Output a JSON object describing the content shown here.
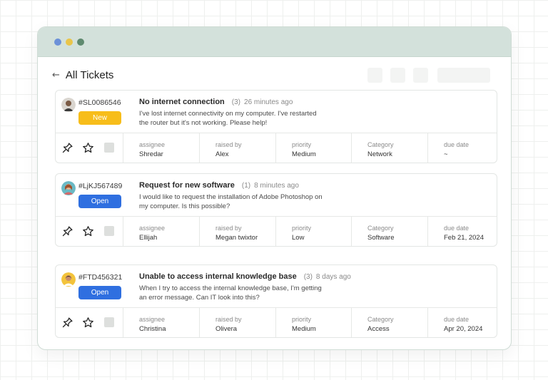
{
  "header": {
    "back_arrow": "←",
    "title": "All Tickets"
  },
  "columns": [
    "assignee",
    "raised by",
    "priority",
    "Category",
    "due date"
  ],
  "colors": {
    "new": "#f7bd1a",
    "open": "#2f6fe0",
    "titlebar": "#d3e1db"
  },
  "tickets": [
    {
      "id": "#SL0086546",
      "status": "New",
      "title": "No internet connection",
      "count": "(3)",
      "time": "26 minutes ago",
      "description": "I've lost internet connectivity on my computer. I've restarted the router but it's not working. Please help!",
      "assignee": "Shredar",
      "raised_by": "Alex",
      "priority": "Medium",
      "category": "Network",
      "due_date": "~"
    },
    {
      "id": "#LjKJ567489",
      "status": "Open",
      "title": "Request for new software",
      "count": "(1)",
      "time": "8 minutes ago",
      "description": "I would like to request the installation of Adobe Photoshop on my computer. Is this possible?",
      "assignee": "Ellijah",
      "raised_by": "Megan twixtor",
      "priority": "Low",
      "category": "Software",
      "due_date": "Feb 21, 2024"
    },
    {
      "id": "#FTD456321",
      "status": "Open",
      "title": "Unable to access internal knowledge base",
      "count": "(3)",
      "time": "8 days ago",
      "description": "When I try to access the internal knowledge base, I'm getting an error message. Can IT look into this?",
      "assignee": "Christina",
      "raised_by": "Olivera",
      "priority": "Medium",
      "category": "Access",
      "due_date": "Apr 20, 2024"
    }
  ]
}
